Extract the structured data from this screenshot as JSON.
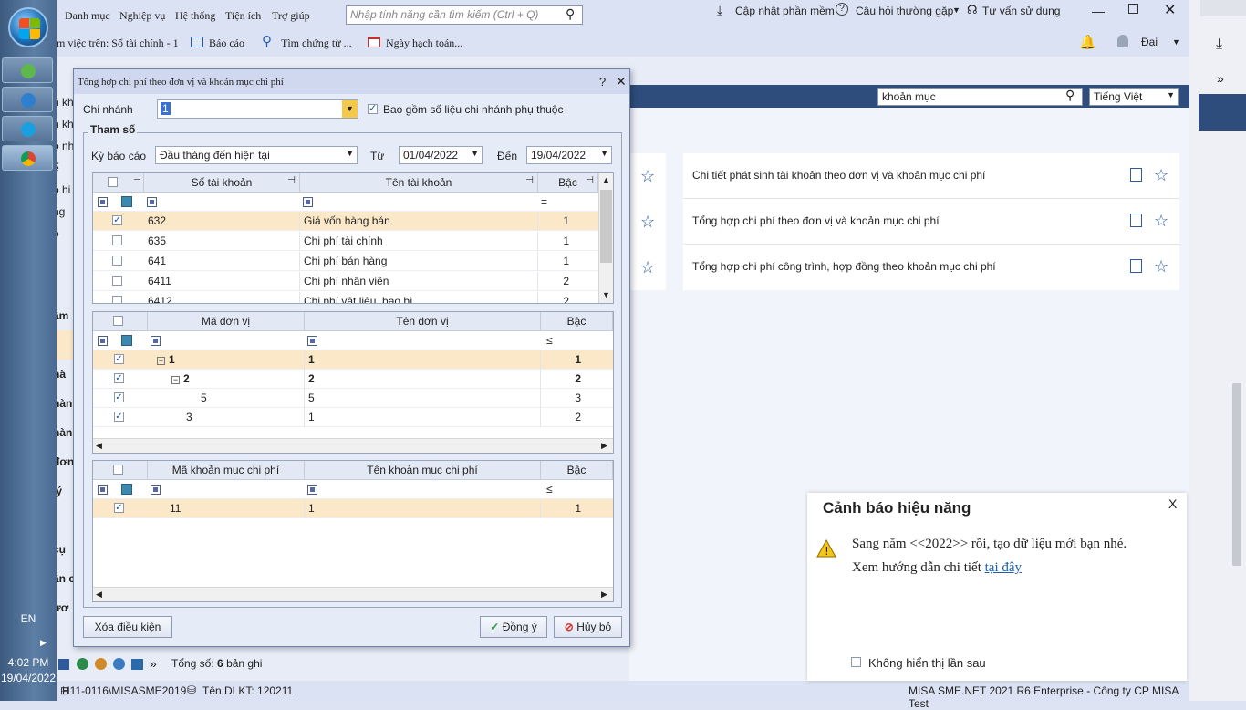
{
  "taskbar": {
    "lang": "EN",
    "time": "4:02 PM",
    "date": "19/04/2022"
  },
  "menu": {
    "items": [
      "Danh mục",
      "Nghiệp vụ",
      "Hệ thống",
      "Tiện ích",
      "Trợ giúp"
    ],
    "search_placeholder": "Nhập tính năng cần tìm kiếm (Ctrl + Q)",
    "update": "Cập nhật phần mềm",
    "faq": "Câu hỏi thường gặp",
    "support": "Tư vấn sử dụng"
  },
  "toolbar": {
    "working_on": "m việc trên: Sổ tài chính - 1",
    "report": "Báo cáo",
    "find": "Tìm chứng từ ...",
    "post_date": "Ngày hạch toán...",
    "user": "Đại"
  },
  "left_labels": [
    "n kh",
    "n kh",
    "o nh",
    "ế",
    "o hi",
    "ng",
    "ệ",
    "âm",
    "hà",
    "hàn",
    "hàn",
    "đơn",
    "lý",
    "cụ",
    "ân c",
    "ươ"
  ],
  "right": {
    "search_value": "khoản mục",
    "language": "Tiếng Việt",
    "reports": [
      "Chi tiết phát sinh tài khoản theo đơn vị và khoản mục chi phí",
      "Tổng hợp chi phí theo đơn vị và khoản mục chi phí",
      "Tổng hợp chi phí công trình, hợp đồng theo khoản mục chi phí"
    ]
  },
  "dialog": {
    "title": "Tổng hợp chi phí theo đơn vị và khoản mục chi phí",
    "help": "?",
    "close": "✕",
    "branch_label": "Chi nhánh",
    "branch_value": "1",
    "include_dependent": "Bao gồm số liệu chi nhánh phụ thuộc",
    "params_label": "Tham số",
    "period_label": "Kỳ báo cáo",
    "period_value": "Đầu tháng đến hiện tại",
    "from_label": "Từ",
    "from_value": "01/04/2022",
    "to_label": "Đến",
    "to_value": "19/04/2022",
    "accounts": {
      "headers": [
        "Số tài khoản",
        "Tên tài khoản",
        "Bậc"
      ],
      "filter_op": "=",
      "rows": [
        {
          "checked": true,
          "code": "632",
          "name": "Giá vốn hàng bán",
          "level": "1"
        },
        {
          "checked": false,
          "code": "635",
          "name": "Chi phí tài chính",
          "level": "1"
        },
        {
          "checked": false,
          "code": "641",
          "name": "Chi phí bán hàng",
          "level": "1"
        },
        {
          "checked": false,
          "code": "6411",
          "name": "Chi phí nhân viên",
          "level": "2"
        },
        {
          "checked": false,
          "code": "6412",
          "name": "Chi phí vật liệu, bao bì",
          "level": "2"
        }
      ]
    },
    "units": {
      "headers": [
        "Mã đơn vị",
        "Tên đơn vị",
        "Bậc"
      ],
      "filter_op": "≤",
      "rows": [
        {
          "checked": true,
          "expand": "−",
          "code": "1",
          "name": "1",
          "level": "1",
          "bold": true,
          "indent": 0
        },
        {
          "checked": true,
          "expand": "−",
          "code": "2",
          "name": "2",
          "level": "2",
          "bold": true,
          "indent": 1
        },
        {
          "checked": true,
          "expand": "",
          "code": "5",
          "name": "5",
          "level": "3",
          "bold": false,
          "indent": 3
        },
        {
          "checked": true,
          "expand": "",
          "code": "3",
          "name": "1",
          "level": "2",
          "bold": false,
          "indent": 2
        }
      ]
    },
    "expense_items": {
      "headers": [
        "Mã khoản mục chi phí",
        "Tên khoản mục chi phí",
        "Bậc"
      ],
      "filter_op": "≤",
      "rows": [
        {
          "checked": true,
          "code": "11",
          "name": "1",
          "level": "1"
        }
      ]
    },
    "clear_button": "Xóa điều kiện",
    "ok_button": "Đồng ý",
    "cancel_button": "Hủy bỏ"
  },
  "total": {
    "label": "Tổng số:",
    "count": "6",
    "suffix": "bản ghi"
  },
  "status": {
    "server": "H11-0116\\MISASME2019",
    "db": "Tên DLKT: 120211",
    "product": "MISA SME.NET 2021 R6 Enterprise - Công ty CP MISA Test"
  },
  "notification": {
    "title": "Cảnh báo hiệu năng",
    "close": "X",
    "line1": "Sang năm <<2022>> rồi, tạo dữ liệu mới bạn nhé.",
    "line2": "Xem hướng dẫn chi tiết",
    "link": "tại đây",
    "dont_show": "Không hiển thị lần sau"
  },
  "colors": {
    "accent": "#2e4d7d",
    "selected_row": "#fbe8c8",
    "link": "#1a5fb4"
  }
}
